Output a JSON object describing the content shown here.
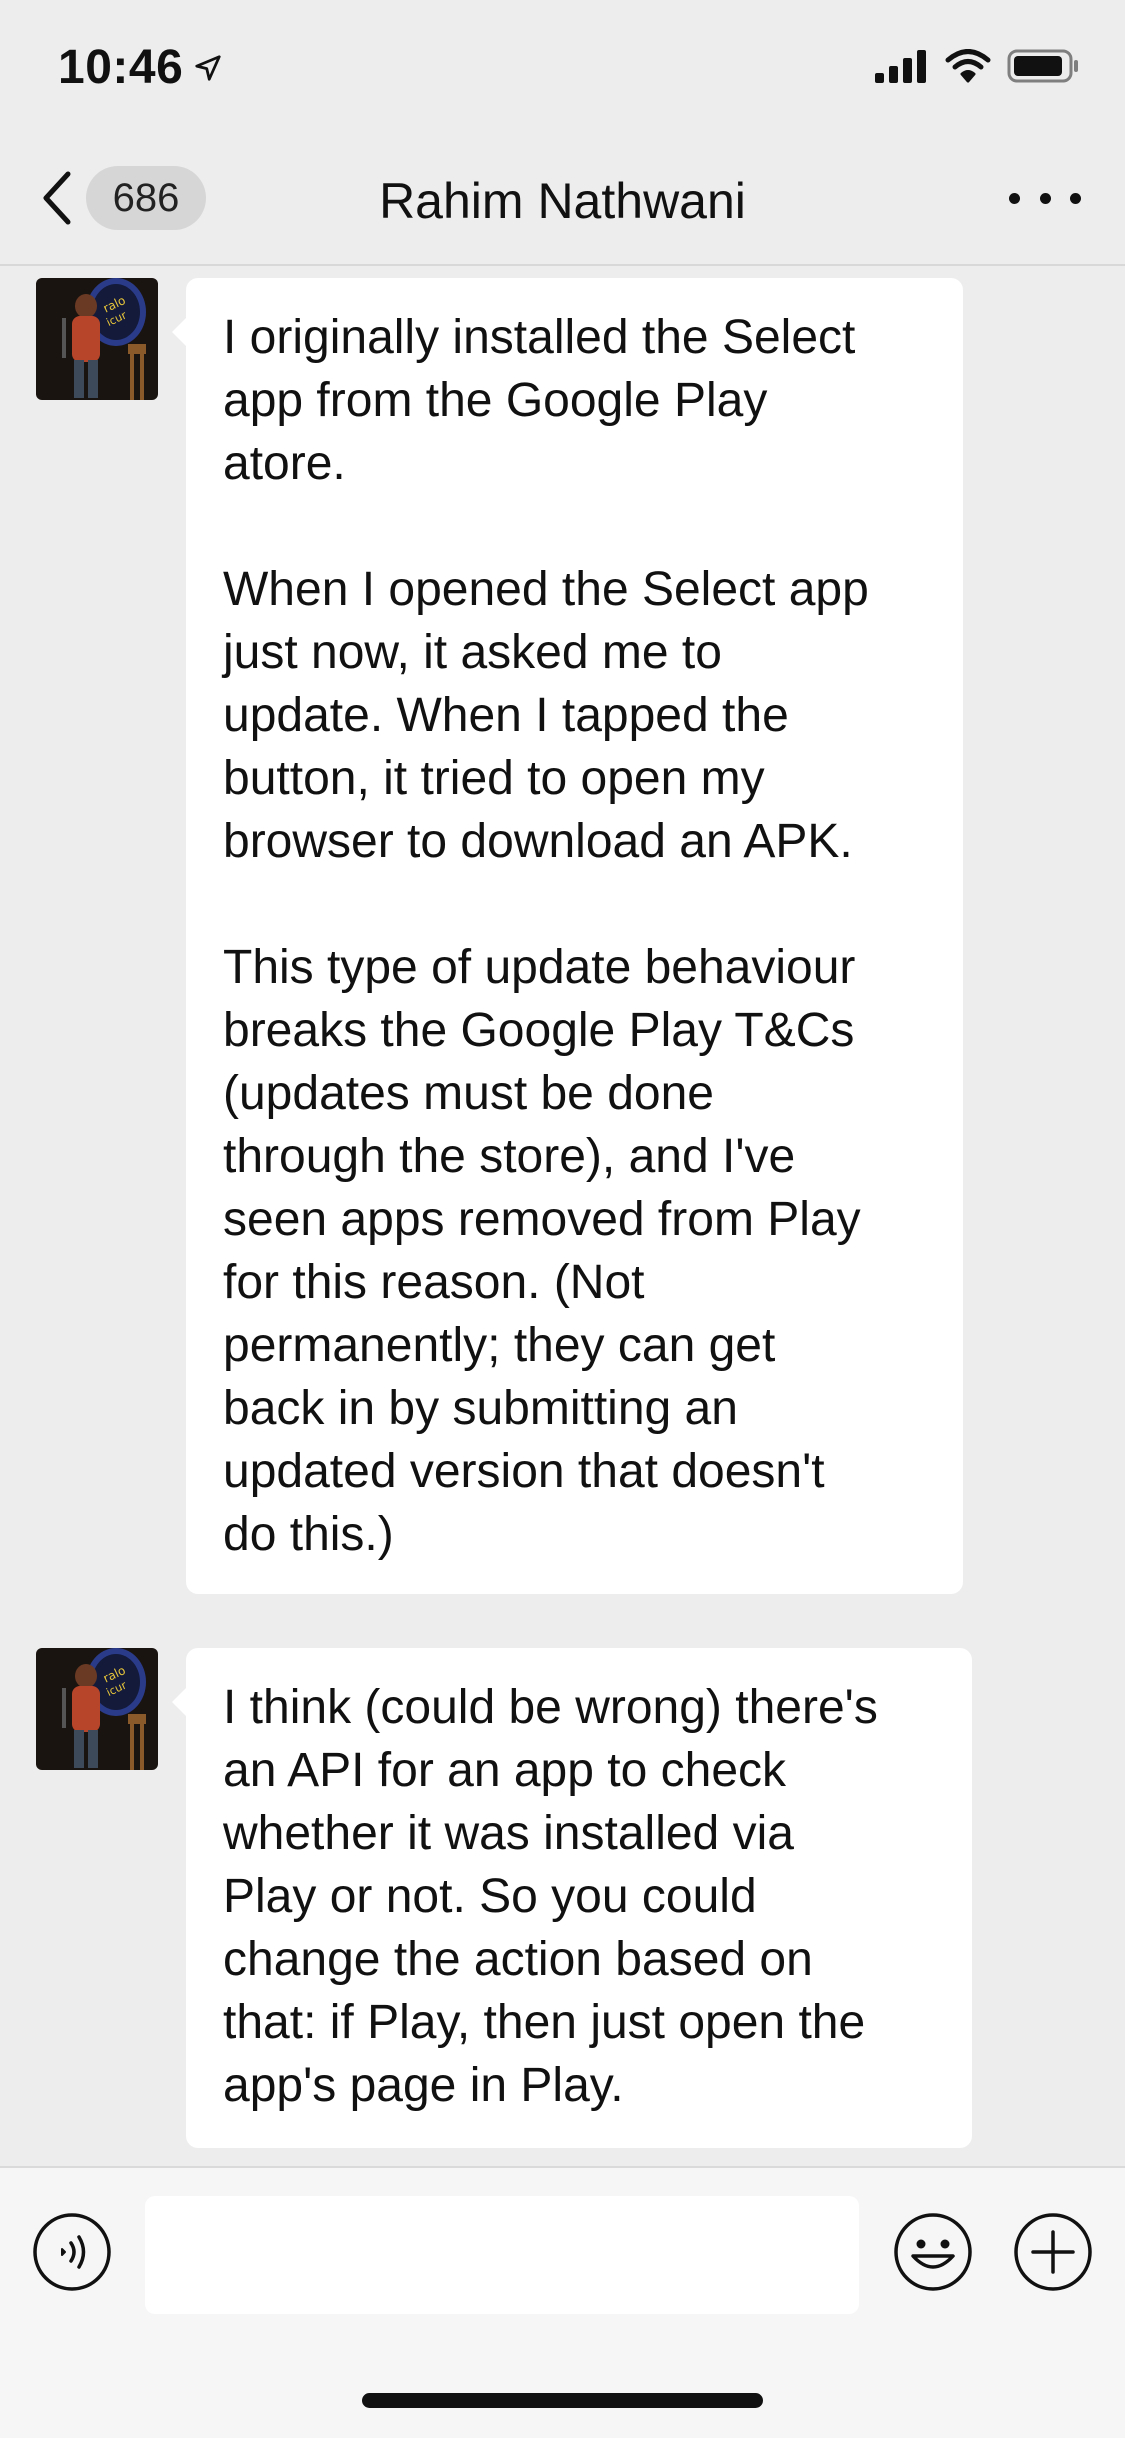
{
  "status_bar": {
    "time": "10:46",
    "icons": [
      "location-arrow-icon",
      "signal-icon",
      "wifi-icon",
      "battery-icon"
    ]
  },
  "nav": {
    "back_icon": "chevron-left-icon",
    "unread_count": "686",
    "title": "Rahim Nathwani",
    "more_icon": "ellipsis-icon"
  },
  "messages": [
    {
      "sender": "Rahim Nathwani",
      "avatar": "avatar-photo",
      "text": "I originally installed the Select\napp from the Google Play\natore.\n\nWhen I opened the Select app\njust now, it asked me to\nupdate. When I tapped the\nbutton, it tried to open my\nbrowser to download an APK.\n\nThis type of update behaviour\nbreaks the Google Play T&Cs\n(updates must be done\nthrough the store), and I've\nseen apps removed from Play\nfor this reason. (Not\npermanently; they can get\nback in by submitting an\nupdated version that doesn't\ndo this.)"
    },
    {
      "sender": "Rahim Nathwani",
      "avatar": "avatar-photo",
      "text": "I think (could be wrong) there's\nan API for an app to check\nwhether it was installed via\nPlay or not. So you could\nchange the action based on\nthat: if Play, then just open the\napp's page in Play."
    }
  ],
  "input_bar": {
    "voice_icon": "voice-icon",
    "input_value": "",
    "emoji_icon": "emoji-icon",
    "plus_icon": "plus-icon"
  },
  "colors": {
    "background": "#ededed",
    "bubble": "#ffffff",
    "input_bar": "#f6f6f6",
    "badge": "#d6d6d6"
  }
}
